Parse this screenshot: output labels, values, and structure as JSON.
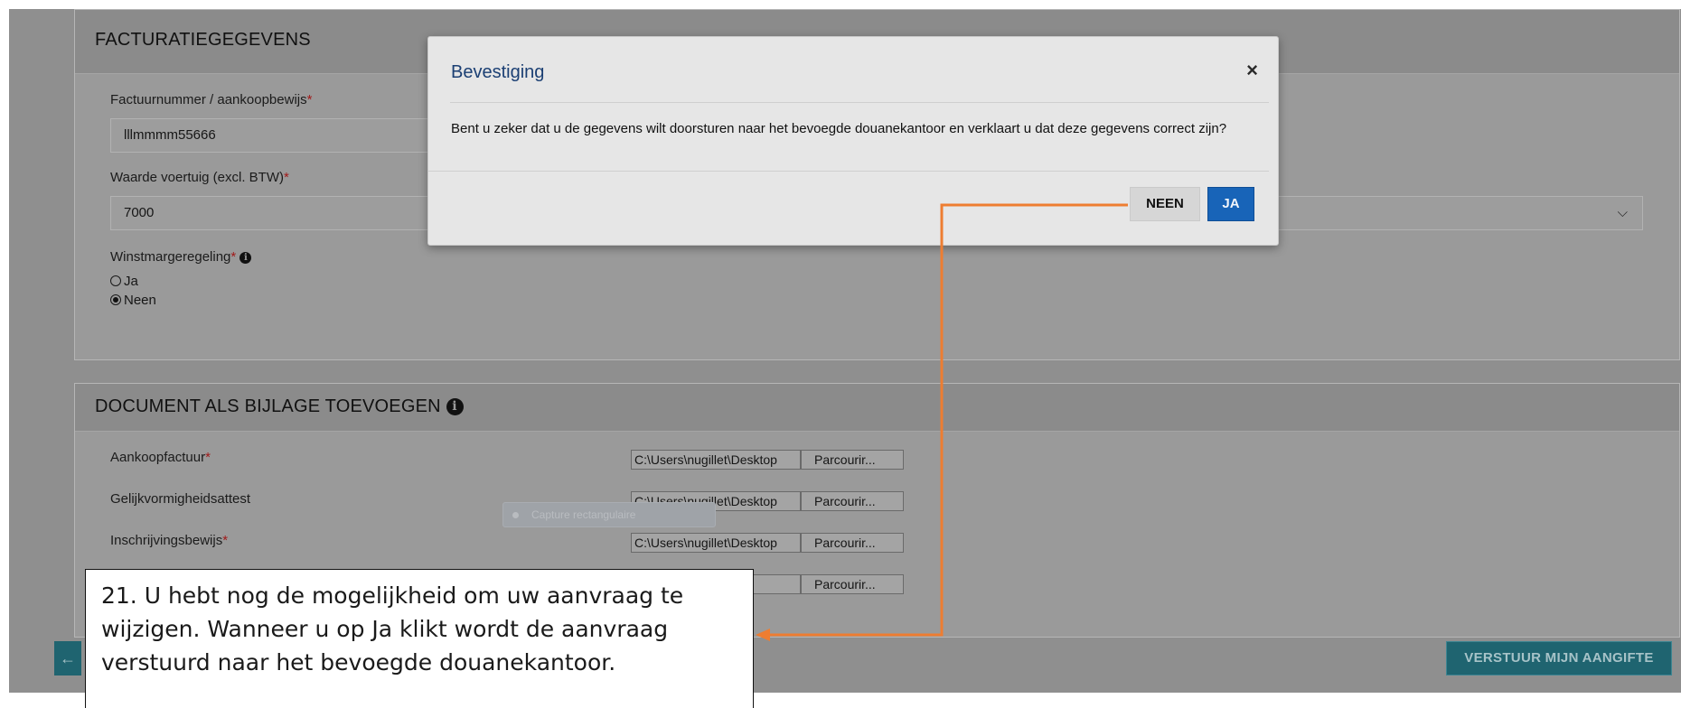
{
  "invoice_section": {
    "title": "FACTURATIEGEGEVENS",
    "invoice_number_label": "Factuurnummer / aankoopbewijs",
    "invoice_number_value": "lllmmmm55666",
    "vehicle_value_label": "Waarde voertuig (excl. BTW)",
    "vehicle_value": "7000",
    "margin_scheme_label": "Winstmargeregeling",
    "radio_yes": "Ja",
    "radio_no": "Neen",
    "selected": "Neen",
    "required_mark": "*"
  },
  "attachments_section": {
    "title": "DOCUMENT ALS BIJLAGE TOEVOEGEN",
    "rows": [
      {
        "label": "Aankoopfactuur",
        "required": true,
        "path": "C:\\Users\\nugillet\\Desktop",
        "button": "Parcourir..."
      },
      {
        "label": "Gelijkvormigheidsattest",
        "required": false,
        "path": "C:\\Users\\nugillet\\Desktop",
        "button": "Parcourir..."
      },
      {
        "label": "Inschrijvingsbewijs",
        "required": true,
        "path": "C:\\Users\\nugillet\\Desktop",
        "button": "Parcourir..."
      },
      {
        "label": "",
        "required": false,
        "path": "",
        "button": "Parcourir..."
      }
    ],
    "ghost_tool": "Capture rectangulaire"
  },
  "footer": {
    "back_arrow": "←",
    "submit_label": "VERSTUUR MIJN AANGIFTE"
  },
  "modal": {
    "title": "Bevestiging",
    "close": "×",
    "body": "Bent u zeker dat u de gegevens wilt doorsturen naar het bevoegde douanekantoor en verklaart u dat deze gegevens correct zijn?",
    "no_label": "NEEN",
    "yes_label": "JA"
  },
  "callout": {
    "text": "21. U hebt nog de mogelijkheid om uw aanvraag te wijzigen. Wanneer u op Ja klikt wordt de aanvraag verstuurd naar het bevoegde douanekantoor."
  },
  "colors": {
    "accent_blue": "#1864b8",
    "submit_teal": "#1f6470",
    "annotation_orange": "#ee7d31",
    "required_red": "#a11a1a"
  },
  "icons": [
    "info-icon",
    "close-icon",
    "chevron-down-icon",
    "arrow-left-icon"
  ]
}
